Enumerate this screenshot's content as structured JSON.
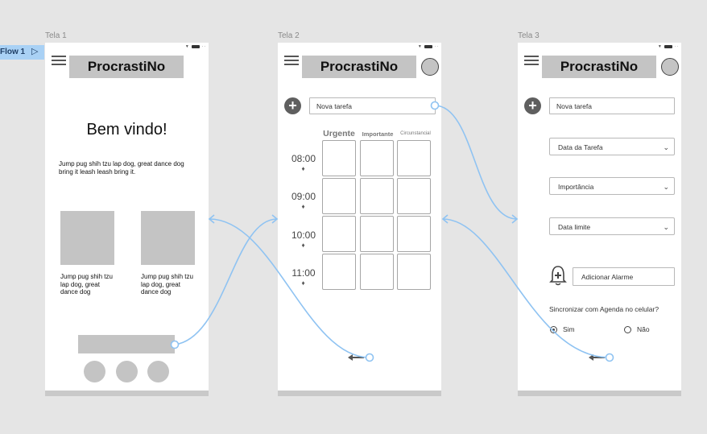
{
  "flow": {
    "label": "Flow 1",
    "play_icon": "play-icon"
  },
  "frames": [
    {
      "label": "Tela 1"
    },
    {
      "label": "Tela 2"
    },
    {
      "label": "Tela 3"
    }
  ],
  "app_title": "ProcrastiNo",
  "screen1": {
    "welcome": "Bem vindo!",
    "intro": "Jump pug shih tzu lap dog, great dance dog bring it leash leash bring it.",
    "card1": "Jump pug shih tzu lap dog, great dance dog",
    "card2": "Jump pug shih tzu lap dog, great dance dog"
  },
  "screen2": {
    "new_task": "Nova tarefa",
    "columns": [
      "Urgente",
      "Importante",
      "Circunstancial"
    ],
    "times": [
      "08:00",
      "09:00",
      "10:00",
      "11:00"
    ]
  },
  "screen3": {
    "new_task": "Nova tarefa",
    "task_date": "Data da Tarefa",
    "importance": "Importância",
    "deadline": "Data limite",
    "alarm": "Adicionar Alarme",
    "sync_question": "Sincronizar com Agenda no celular?",
    "yes": "Sim",
    "no": "Não",
    "sync_selected": "Sim"
  },
  "colors": {
    "connector": "#8fc3f2",
    "frame_bg": "#ffffff",
    "canvas": "#e5e5e5",
    "placeholder": "#c4c4c4"
  }
}
